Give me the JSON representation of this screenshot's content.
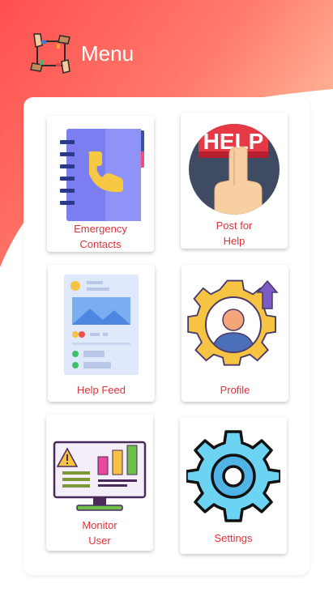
{
  "header": {
    "title": "Menu",
    "logo_icon": "helping-hands-icon"
  },
  "colors": {
    "gradient_start": "#ff5a5a",
    "gradient_end": "#ffb08f",
    "label_red": "#e0323b"
  },
  "menu": {
    "items": [
      {
        "label": "Emergency\nContacts",
        "icon": "address-book-icon"
      },
      {
        "label": "Post for\nHelp",
        "icon": "help-button-icon"
      },
      {
        "label": "Help Feed",
        "icon": "feed-document-icon"
      },
      {
        "label": "Profile",
        "icon": "profile-gear-icon"
      },
      {
        "label": "Monitor\nUser",
        "icon": "monitor-dashboard-icon"
      },
      {
        "label": "Settings",
        "icon": "settings-gear-icon"
      }
    ]
  }
}
